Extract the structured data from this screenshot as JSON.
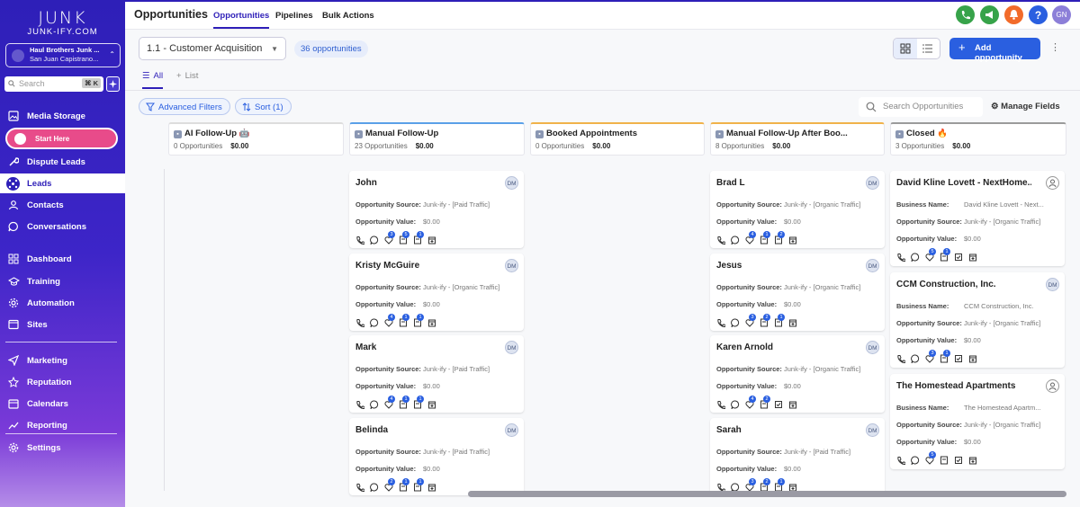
{
  "sidebar": {
    "logo_main": "JUNK",
    "logo_sub": "JUNK-IFY.COM",
    "account_name": "Haul Brothers Junk ...",
    "account_location": "San Juan Capistrano...",
    "search_placeholder": "Search",
    "search_kbd": "⌘ K",
    "start_here": "Start Here",
    "items": [
      {
        "label": "Media Storage",
        "icon": "image-icon"
      },
      {
        "label": "Dispute Leads",
        "icon": "wrench-icon"
      },
      {
        "label": "Leads",
        "icon": "hub-icon"
      },
      {
        "label": "Contacts",
        "icon": "person-icon"
      },
      {
        "label": "Conversations",
        "icon": "chat-icon"
      },
      {
        "label": "Dashboard",
        "icon": "grid-icon"
      },
      {
        "label": "Training",
        "icon": "graduation-icon"
      },
      {
        "label": "Automation",
        "icon": "gear-icon"
      },
      {
        "label": "Sites",
        "icon": "globe-icon"
      },
      {
        "label": "Marketing",
        "icon": "send-icon"
      },
      {
        "label": "Reputation",
        "icon": "star-icon"
      },
      {
        "label": "Calendars",
        "icon": "calendar-icon"
      },
      {
        "label": "Reporting",
        "icon": "chart-icon"
      },
      {
        "label": "Settings",
        "icon": "settings-icon"
      }
    ]
  },
  "header": {
    "title": "Opportunities",
    "tabs": [
      "Opportunities",
      "Pipelines",
      "Bulk Actions"
    ],
    "avatar": "GN"
  },
  "toolbar": {
    "pipeline": "1.1 - Customer Acquisition",
    "count": "36 opportunities",
    "add_label": "Add opportunity",
    "view_all": "All",
    "view_list": "List",
    "advanced_filters": "Advanced Filters",
    "sort": "Sort (1)",
    "search_placeholder": "Search Opportunities",
    "manage_fields": "Manage Fields"
  },
  "columns": [
    {
      "title": "AI Follow-Up 🤖",
      "count": "0 Opportunities",
      "value": "$0.00"
    },
    {
      "title": "Manual Follow-Up",
      "count": "23 Opportunities",
      "value": "$0.00"
    },
    {
      "title": "Booked Appointments",
      "count": "0 Opportunities",
      "value": "$0.00"
    },
    {
      "title": "Manual Follow-Up After Boo...",
      "count": "8 Opportunities",
      "value": "$0.00"
    },
    {
      "title": "Closed 🔥",
      "count": "3 Opportunities",
      "value": "$0.00"
    }
  ],
  "labels": {
    "source": "Opportunity Source:",
    "value": "Opportunity Value:",
    "business": "Business Name:"
  },
  "manual_cards": [
    {
      "name": "John",
      "initials": "DM",
      "source": "Junk-ify - [Paid Traffic]",
      "value": "$0.00",
      "b1": "3",
      "b2": "5",
      "b3": "1"
    },
    {
      "name": "Kristy McGuire",
      "initials": "DM",
      "source": "Junk-ify - [Organic Traffic]",
      "value": "$0.00",
      "b1": "4",
      "b2": "1",
      "b3": "1"
    },
    {
      "name": "Mark",
      "initials": "DM",
      "source": "Junk-ify - [Paid Traffic]",
      "value": "$0.00",
      "b1": "4",
      "b2": "1",
      "b3": "1"
    },
    {
      "name": "Belinda",
      "initials": "DM",
      "source": "Junk-ify - [Paid Traffic]",
      "value": "$0.00",
      "b1": "2",
      "b2": "1",
      "b3": "1"
    }
  ],
  "after_cards": [
    {
      "name": "Brad L",
      "initials": "DM",
      "source": "Junk-ify - [Organic Traffic]",
      "value": "$0.00",
      "b1": "4",
      "b2": "1",
      "b3": "2"
    },
    {
      "name": "Jesus",
      "initials": "DM",
      "source": "Junk-ify - [Organic Traffic]",
      "value": "$0.00",
      "b1": "3",
      "b2": "2",
      "b3": "1"
    },
    {
      "name": "Karen Arnold",
      "initials": "DM",
      "source": "Junk-ify - [Organic Traffic]",
      "value": "$0.00",
      "b1": "4",
      "b2": "2",
      "b3": ""
    },
    {
      "name": "Sarah",
      "initials": "DM",
      "source": "Junk-ify - [Paid Traffic]",
      "value": "$0.00",
      "b1": "3",
      "b2": "2",
      "b3": "1"
    }
  ],
  "closed_cards": [
    {
      "name": "David Kline Lovett - NextHome...",
      "business": "David Kline Lovett - Next...",
      "source": "Junk-ify - [Organic Traffic]",
      "value": "$0.00",
      "b1": "5",
      "b2": "1"
    },
    {
      "name": "CCM Construction, Inc.",
      "initials": "DM",
      "business": "CCM Construction, Inc.",
      "source": "Junk-ify - [Organic Traffic]",
      "value": "$0.00",
      "b1": "3",
      "b2": "1"
    },
    {
      "name": "The Homestead Apartments",
      "business": "The Homestead Apartm...",
      "source": "Junk-ify - [Organic Traffic]",
      "value": "$0.00",
      "b1": "5",
      "b2": ""
    }
  ]
}
